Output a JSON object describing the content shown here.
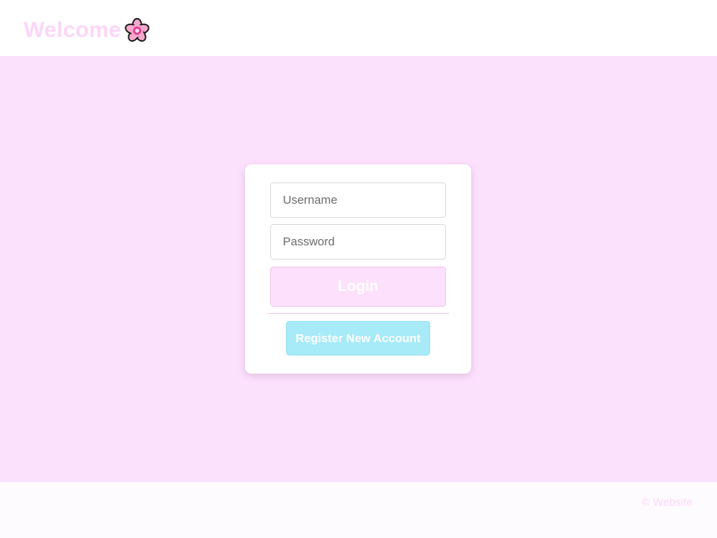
{
  "header": {
    "title": "Welcome",
    "logo_icon": "cherry-blossom-icon"
  },
  "login_form": {
    "username_placeholder": "Username",
    "password_placeholder": "Password",
    "login_label": "Login",
    "register_label": "Register New Account"
  },
  "footer": {
    "copyright": "© Website"
  },
  "colors": {
    "brand_pink": "#fcd6f7",
    "page_background": "#fce1fd",
    "login_button": "#fde0fb",
    "register_button": "#a7eaf8"
  }
}
